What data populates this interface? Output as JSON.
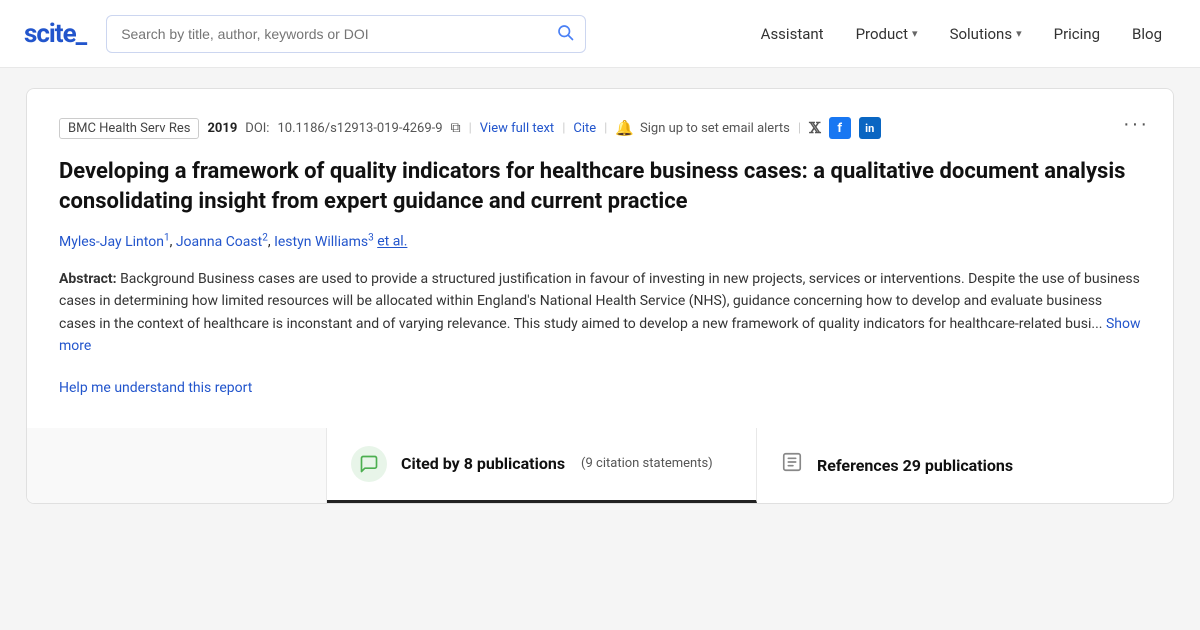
{
  "header": {
    "logo": "scite_",
    "search_placeholder": "Search by title, author, keywords or DOI",
    "nav_items": [
      {
        "label": "Assistant",
        "has_dropdown": false
      },
      {
        "label": "Product",
        "has_dropdown": true
      },
      {
        "label": "Solutions",
        "has_dropdown": true
      },
      {
        "label": "Pricing",
        "has_dropdown": false
      },
      {
        "label": "Blog",
        "has_dropdown": false
      }
    ]
  },
  "paper": {
    "journal": "BMC Health Serv Res",
    "year": "2019",
    "doi_label": "DOI:",
    "doi_value": "10.1186/s12913-019-4269-9",
    "view_full_text": "View full text",
    "cite": "Cite",
    "alert_text": "Sign up to set email alerts",
    "title": "Developing a framework of quality indicators for healthcare business cases: a qualitative document analysis consolidating insight from expert guidance and current practice",
    "authors": [
      {
        "name": "Myles-Jay Linton",
        "sup": "1"
      },
      {
        "name": "Joanna Coast",
        "sup": "2"
      },
      {
        "name": "Iestyn Williams",
        "sup": "3"
      }
    ],
    "et_al": "et al.",
    "abstract_label": "Abstract:",
    "abstract_text": "Background Business cases are used to provide a structured justification in favour of investing in new projects, services or interventions. Despite the use of business cases in determining how limited resources will be allocated within England's National Health Service (NHS), guidance concerning how to develop and evaluate business cases in the context of healthcare is inconstant and of varying relevance. This study aimed to develop a new framework of quality indicators for healthcare-related busi...",
    "show_more": "Show more",
    "help_link": "Help me understand this report"
  },
  "stats": {
    "cited_icon": "💬",
    "cited_main": "Cited by 8 publications",
    "cited_sub": "(9 citation statements)",
    "refs_icon": "📄",
    "refs_text": "References 29 publications"
  },
  "icons": {
    "search": "🔍",
    "bell": "🔔",
    "twitter": "𝕏",
    "facebook": "f",
    "linkedin": "in",
    "copy": "⧉",
    "more": "···",
    "chevron_down": "▾"
  }
}
